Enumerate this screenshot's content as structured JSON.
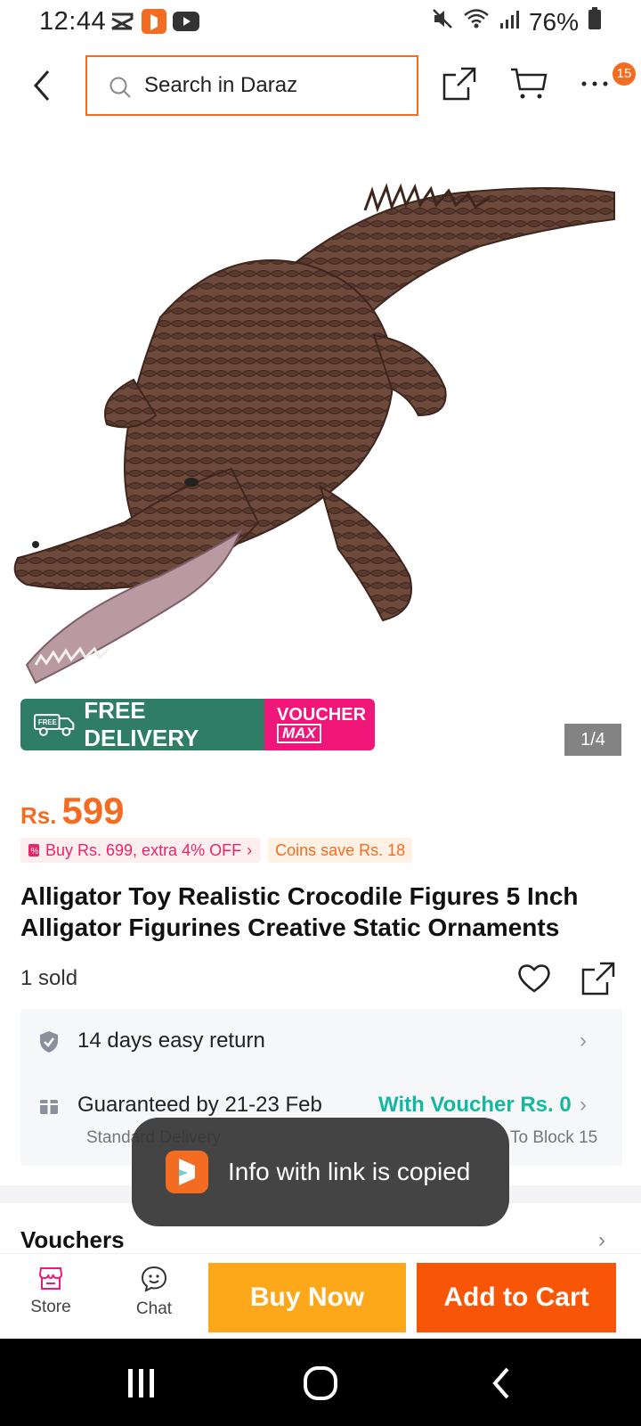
{
  "status_bar": {
    "time": "12:44",
    "battery": "76%"
  },
  "header": {
    "search_placeholder": "Search in Daraz",
    "cart_badge": "15"
  },
  "gallery": {
    "image_alt": "Alligator toy figurine",
    "counter": "1/4"
  },
  "promo": {
    "free_delivery": "FREE DELIVERY",
    "free_small": "FREE",
    "voucher_line1": "VOUCHER",
    "voucher_line2": "MAX"
  },
  "price": {
    "currency": "Rs.",
    "amount": "599"
  },
  "tags": {
    "deal": "Buy Rs. 699, extra 4% OFF",
    "coins": "Coins save Rs. 18"
  },
  "product": {
    "title": "Alligator Toy Realistic Crocodile Figures 5 Inch Alligator Figurines Creative Static Ornaments",
    "sold": "1 sold"
  },
  "service": {
    "return_text": "14 days easy return",
    "delivery_text": "Guaranteed by 21-23 Feb",
    "delivery_sub": "Standard Delivery",
    "voucher_text": "With Voucher Rs. 0",
    "block_text": "To Block 15"
  },
  "vouchers": {
    "heading": "Vouchers"
  },
  "toast": {
    "message": "Info with link is copied"
  },
  "actions": {
    "store": "Store",
    "chat": "Chat",
    "buy_now": "Buy Now",
    "add_to_cart": "Add to Cart"
  },
  "colors": {
    "brand_orange": "#f85606",
    "buy_yellow": "#fda81b",
    "free_green": "#2e7d64",
    "voucher_pink": "#f0167a",
    "teal": "#14b8a0"
  }
}
